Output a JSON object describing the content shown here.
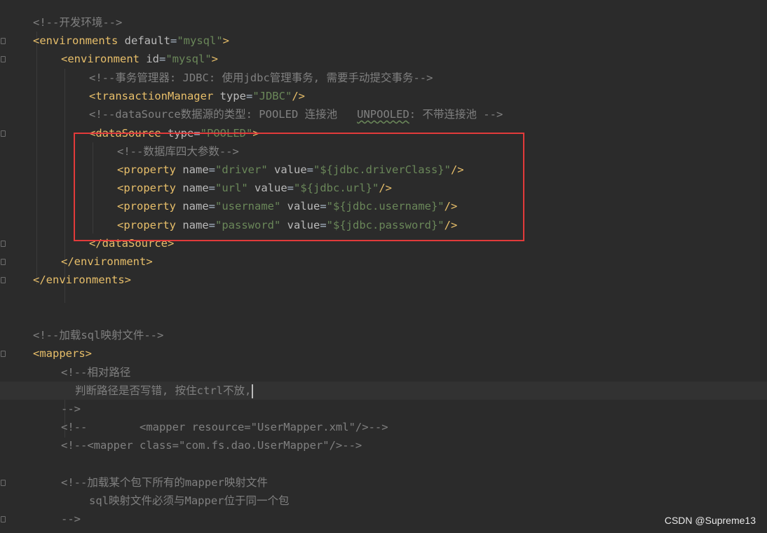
{
  "editor": {
    "lines": [
      {
        "tokens": [
          {
            "t": "cmt",
            "v": "<!--开发环境-->"
          }
        ]
      },
      {
        "tokens": [
          {
            "t": "tag",
            "v": "<environments "
          },
          {
            "t": "attr",
            "v": "default"
          },
          {
            "t": "plain",
            "v": "="
          },
          {
            "t": "str",
            "v": "\"mysql\""
          },
          {
            "t": "tag",
            "v": ">"
          }
        ]
      },
      {
        "tokens": [
          {
            "t": "tag",
            "v": "<environment "
          },
          {
            "t": "attr",
            "v": "id"
          },
          {
            "t": "plain",
            "v": "="
          },
          {
            "t": "str",
            "v": "\"mysql\""
          },
          {
            "t": "tag",
            "v": ">"
          }
        ]
      },
      {
        "tokens": [
          {
            "t": "cmt",
            "v": "<!--事务管理器: JDBC: 使用jdbc管理事务, 需要手动提交事务-->"
          }
        ]
      },
      {
        "tokens": [
          {
            "t": "tag",
            "v": "<transactionManager "
          },
          {
            "t": "attr",
            "v": "type"
          },
          {
            "t": "plain",
            "v": "="
          },
          {
            "t": "str",
            "v": "\"JDBC\""
          },
          {
            "t": "tag",
            "v": "/>"
          }
        ]
      },
      {
        "tokens": [
          {
            "t": "cmt",
            "v": "<!--dataSource数据源的类型: POOLED 连接池   "
          },
          {
            "t": "cmt typo",
            "v": "UNPOOLED"
          },
          {
            "t": "cmt",
            "v": ": 不带连接池 -->"
          }
        ]
      },
      {
        "tokens": [
          {
            "t": "tag",
            "v": "<dataSource "
          },
          {
            "t": "attr",
            "v": "type"
          },
          {
            "t": "plain",
            "v": "="
          },
          {
            "t": "str",
            "v": "\"POOLED\""
          },
          {
            "t": "tag",
            "v": ">"
          }
        ]
      },
      {
        "tokens": [
          {
            "t": "cmt",
            "v": "<!--数据库四大参数-->"
          }
        ]
      },
      {
        "tokens": [
          {
            "t": "tag",
            "v": "<property "
          },
          {
            "t": "attr",
            "v": "name"
          },
          {
            "t": "plain",
            "v": "="
          },
          {
            "t": "str",
            "v": "\"driver\""
          },
          {
            "t": "attr",
            "v": " value"
          },
          {
            "t": "plain",
            "v": "="
          },
          {
            "t": "str",
            "v": "\"${jdbc.driverClass}\""
          },
          {
            "t": "tag",
            "v": "/>"
          }
        ]
      },
      {
        "tokens": [
          {
            "t": "tag",
            "v": "<property "
          },
          {
            "t": "attr",
            "v": "name"
          },
          {
            "t": "plain",
            "v": "="
          },
          {
            "t": "str",
            "v": "\"url\""
          },
          {
            "t": "attr",
            "v": " value"
          },
          {
            "t": "plain",
            "v": "="
          },
          {
            "t": "str",
            "v": "\"${jdbc.url}\""
          },
          {
            "t": "tag",
            "v": "/>"
          }
        ]
      },
      {
        "tokens": [
          {
            "t": "tag",
            "v": "<property "
          },
          {
            "t": "attr",
            "v": "name"
          },
          {
            "t": "plain",
            "v": "="
          },
          {
            "t": "str",
            "v": "\"username\""
          },
          {
            "t": "attr",
            "v": " value"
          },
          {
            "t": "plain",
            "v": "="
          },
          {
            "t": "str",
            "v": "\"${jdbc.username}\""
          },
          {
            "t": "tag",
            "v": "/>"
          }
        ]
      },
      {
        "tokens": [
          {
            "t": "tag",
            "v": "<property "
          },
          {
            "t": "attr",
            "v": "name"
          },
          {
            "t": "plain",
            "v": "="
          },
          {
            "t": "str",
            "v": "\"password\""
          },
          {
            "t": "attr",
            "v": " value"
          },
          {
            "t": "plain",
            "v": "="
          },
          {
            "t": "str",
            "v": "\"${jdbc.password}\""
          },
          {
            "t": "tag",
            "v": "/>"
          }
        ]
      },
      {
        "tokens": [
          {
            "t": "tag",
            "v": "</dataSource>"
          }
        ]
      },
      {
        "tokens": [
          {
            "t": "tag",
            "v": "</environment>"
          }
        ]
      },
      {
        "tokens": [
          {
            "t": "tag",
            "v": "</environments>"
          }
        ]
      },
      {
        "tokens": []
      },
      {
        "tokens": []
      },
      {
        "tokens": [
          {
            "t": "cmt",
            "v": "<!--加载sql映射文件-->"
          }
        ]
      },
      {
        "tokens": [
          {
            "t": "tag",
            "v": "<mappers>"
          }
        ]
      },
      {
        "tokens": [
          {
            "t": "cmt",
            "v": "<!--相对路径"
          }
        ]
      },
      {
        "tokens": [
          {
            "t": "cmt",
            "v": "判断路径是否写错, 按住ctrl不放,"
          }
        ],
        "caret": true
      },
      {
        "tokens": [
          {
            "t": "cmt",
            "v": "-->"
          }
        ]
      },
      {
        "tokens": [
          {
            "t": "cmt",
            "v": "<!--        <mapper resource=\"UserMapper.xml\"/>-->"
          }
        ]
      },
      {
        "tokens": [
          {
            "t": "cmt",
            "v": "<!--<mapper class=\"com.fs.dao.UserMapper\"/>-->"
          }
        ]
      },
      {
        "tokens": []
      },
      {
        "tokens": [
          {
            "t": "cmt",
            "v": "<!--加载某个包下所有的mapper映射文件"
          }
        ]
      },
      {
        "tokens": [
          {
            "t": "cmt",
            "v": "sql映射文件必须与Mapper位于同一个包"
          }
        ]
      },
      {
        "tokens": [
          {
            "t": "cmt",
            "v": "-->"
          }
        ]
      }
    ]
  },
  "watermark": "CSDN @Supreme13",
  "colors": {
    "background": "#2b2b2b",
    "comment": "#808080",
    "tag": "#e8bf6a",
    "attribute": "#bababa",
    "string": "#6a8759",
    "highlight_box": "#e23a3a"
  }
}
